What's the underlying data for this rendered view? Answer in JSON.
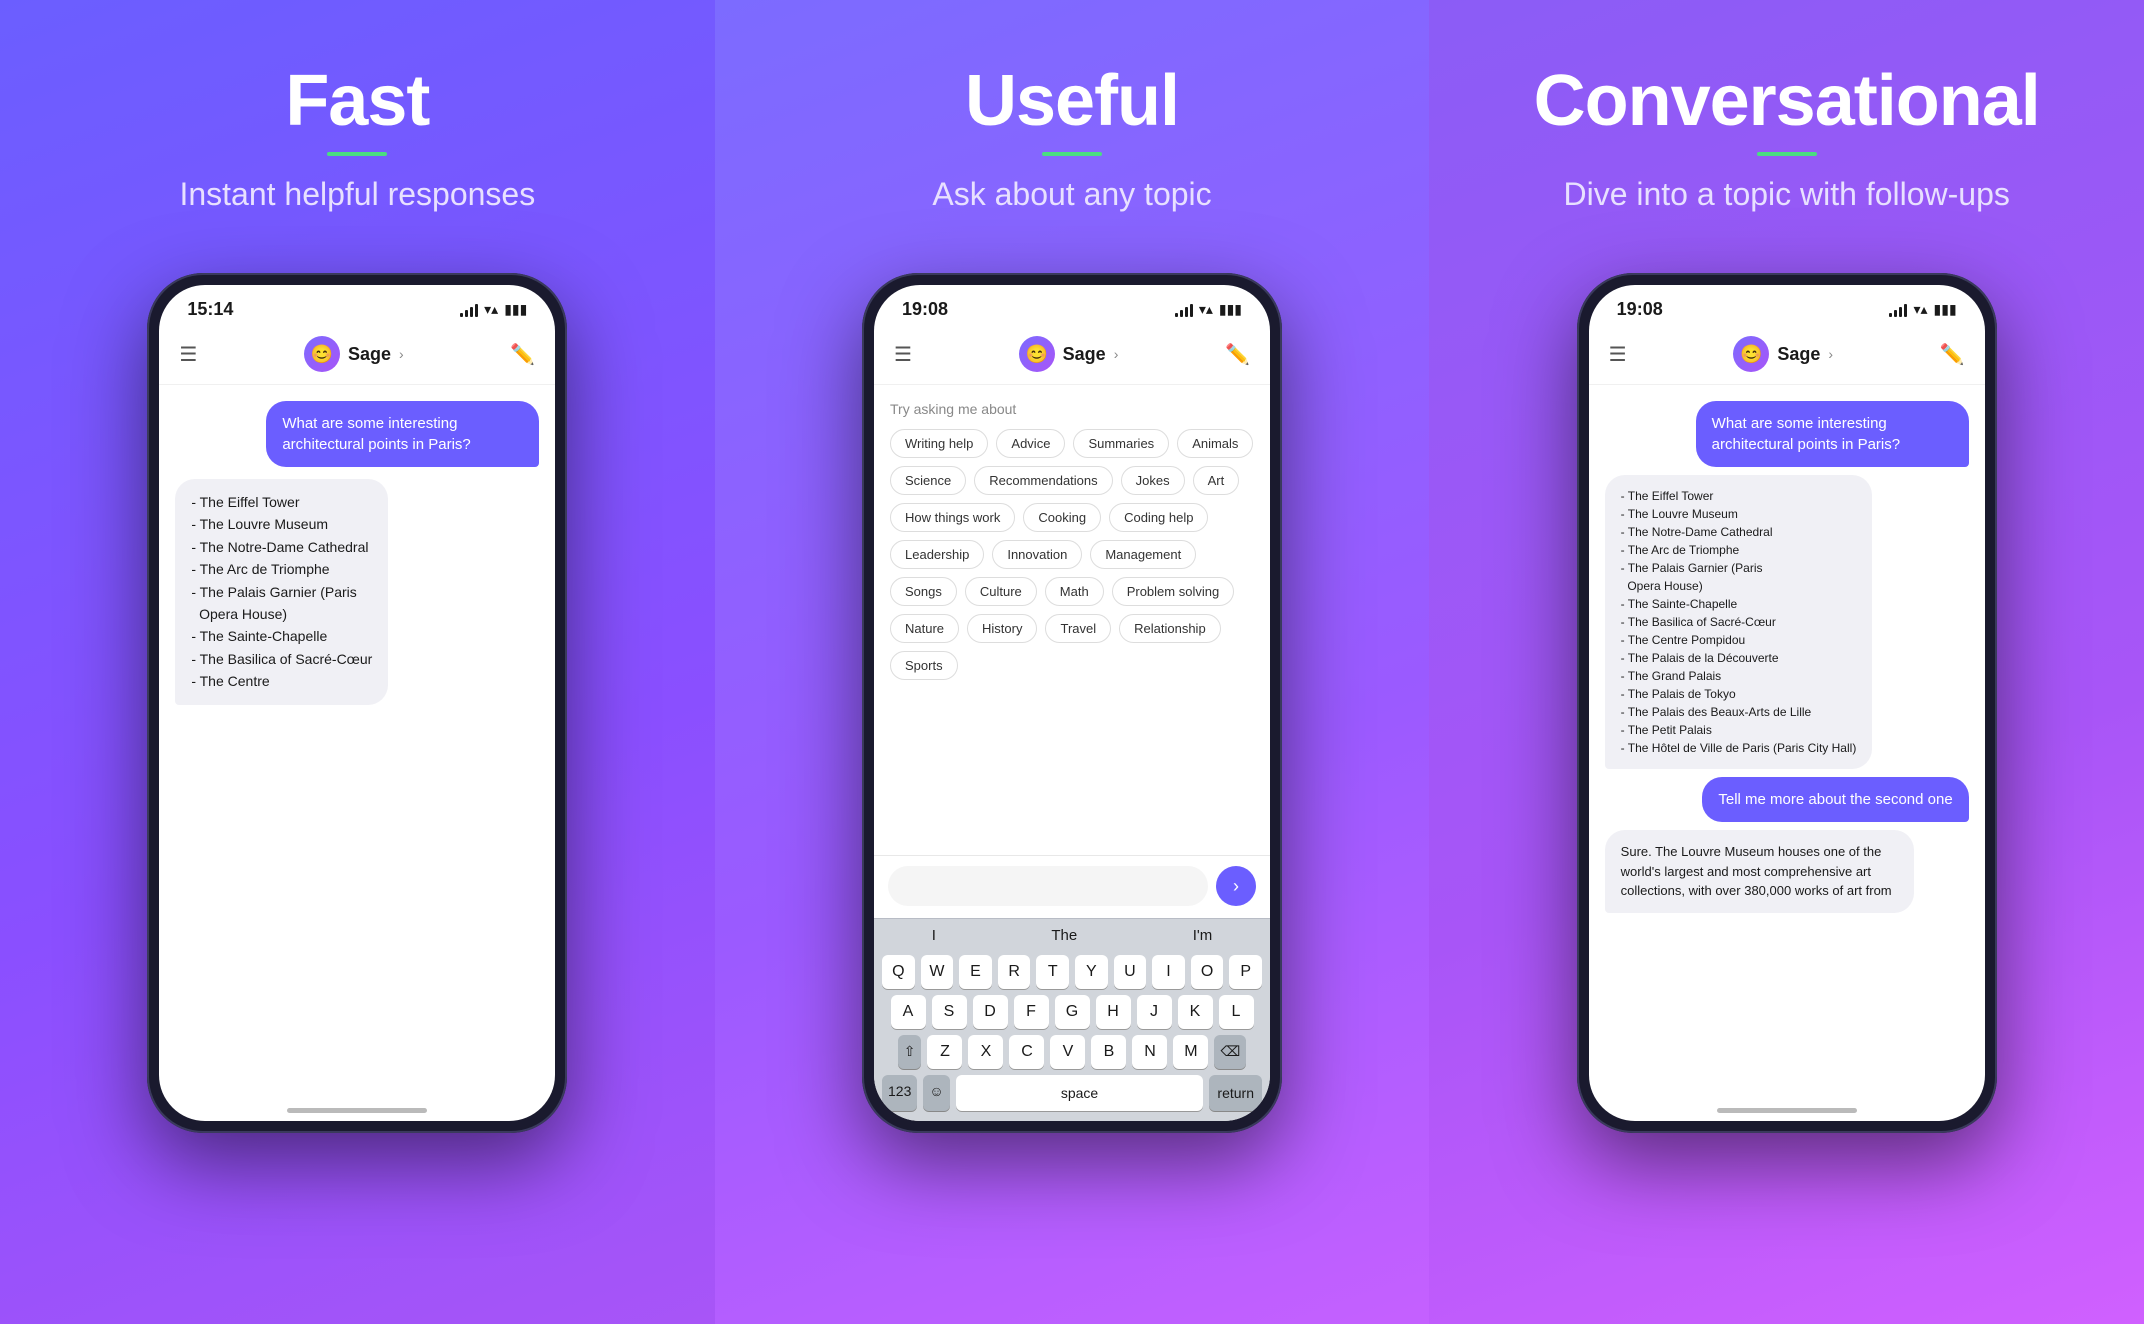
{
  "panels": [
    {
      "id": "fast",
      "title": "Fast",
      "subtitle": "Instant helpful responses",
      "phone": {
        "time": "15:14",
        "avatar_emoji": "😊",
        "agent_name": "Sage",
        "user_message": "What are some interesting architectural points in Paris?",
        "ai_response": "- The Eiffel Tower\n- The Louvre Museum\n- The Notre-Dame Cathedral\n- The Arc de Triomphe\n- The Palais Garnier (Paris Opera House)\n- The Sainte-Chapelle\n- The Basilica of Sacré-Cœur\n- The Centre",
        "type": "chat"
      }
    },
    {
      "id": "useful",
      "title": "Useful",
      "subtitle": "Ask about any topic",
      "phone": {
        "time": "19:08",
        "avatar_emoji": "😊",
        "agent_name": "Sage",
        "topics_label": "Try asking me about",
        "topics": [
          "Writing help",
          "Advice",
          "Summaries",
          "Animals",
          "Science",
          "Recommendations",
          "Jokes",
          "Art",
          "How things work",
          "Cooking",
          "Coding help",
          "Leadership",
          "Innovation",
          "Management",
          "Songs",
          "Culture",
          "Math",
          "Problem solving",
          "Nature",
          "History",
          "Travel",
          "Relationship",
          "Sports"
        ],
        "type": "topics",
        "keyboard": {
          "suggestions": [
            "I",
            "The",
            "I'm"
          ],
          "rows": [
            [
              "Q",
              "W",
              "E",
              "R",
              "T",
              "Y",
              "U",
              "I",
              "O",
              "P"
            ],
            [
              "A",
              "S",
              "D",
              "F",
              "G",
              "H",
              "J",
              "K",
              "L"
            ],
            [
              "Z",
              "X",
              "C",
              "V",
              "B",
              "N",
              "M"
            ]
          ]
        }
      }
    },
    {
      "id": "conversational",
      "title": "Conversational",
      "subtitle": "Dive into a topic with follow-ups",
      "phone": {
        "time": "19:08",
        "avatar_emoji": "😊",
        "agent_name": "Sage",
        "user_message": "What are some interesting architectural points in Paris?",
        "ai_response": "- The Eiffel Tower\n- The Louvre Museum\n- The Notre-Dame Cathedral\n- The Arc de Triomphe\n- The Palais Garnier (Paris Opera House)\n- The Sainte-Chapelle\n- The Basilica of Sacré-Cœur\n- The Centre Pompidou\n- The Palais de la Découverte\n- The Grand Palais\n- The Palais de Tokyo\n- The Palais des Beaux-Arts de Lille\n- The Petit Palais\n- The Hôtel de Ville de Paris (Paris City Hall)",
        "followup_message": "Tell me more about the second one",
        "followup_response": "Sure. The Louvre Museum houses one of the world's largest and most comprehensive art collections, with over 380,000 works of art from",
        "type": "conversation"
      }
    }
  ]
}
